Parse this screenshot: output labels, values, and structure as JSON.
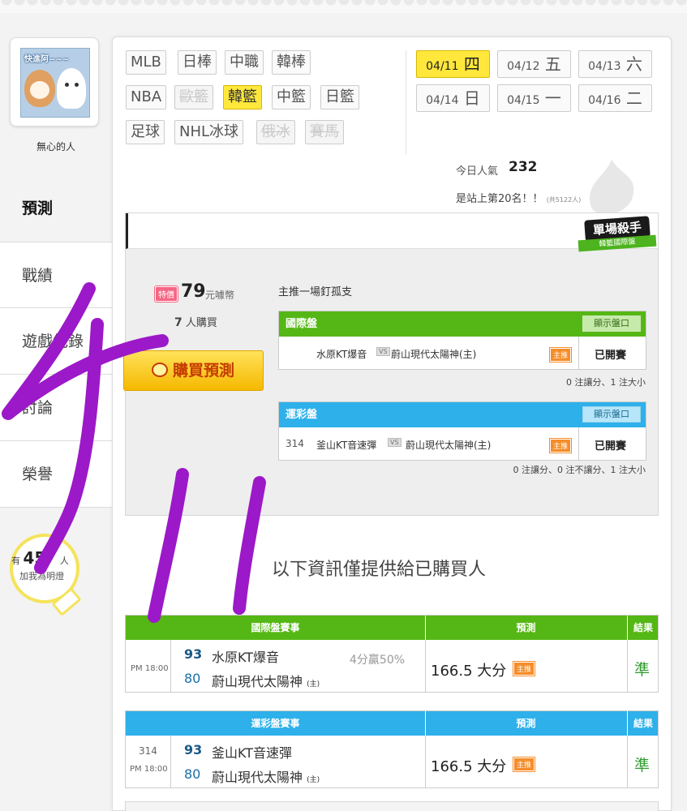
{
  "sidebar": {
    "avatar_caption": "快進阿~~~",
    "username": "無心的人",
    "nav": [
      {
        "label": "預測",
        "active": true
      },
      {
        "label": "戰績",
        "active": false
      },
      {
        "label": "遊戲紀錄",
        "active": false
      },
      {
        "label": "討論",
        "active": false
      },
      {
        "label": "榮譽",
        "active": false
      }
    ],
    "bulb": {
      "prefix": "有",
      "count": "45",
      "suffix": "人",
      "caption": "加我為明燈"
    }
  },
  "categories": [
    {
      "label": "MLB",
      "state": "normal"
    },
    {
      "label": "日棒",
      "state": "normal"
    },
    {
      "label": "中職",
      "state": "normal"
    },
    {
      "label": "韓棒",
      "state": "normal"
    },
    {
      "label": "NBA",
      "state": "normal"
    },
    {
      "label": "歐籃",
      "state": "disabled"
    },
    {
      "label": "韓籃",
      "state": "active"
    },
    {
      "label": "中籃",
      "state": "normal"
    },
    {
      "label": "日籃",
      "state": "normal"
    },
    {
      "label": "足球",
      "state": "normal"
    },
    {
      "label": "NHL冰球",
      "state": "normal"
    },
    {
      "label": "俄冰",
      "state": "disabled"
    },
    {
      "label": "賽馬",
      "state": "disabled"
    }
  ],
  "dates": [
    {
      "date": "04/11",
      "day": "四",
      "active": true
    },
    {
      "date": "04/12",
      "day": "五",
      "active": false
    },
    {
      "date": "04/13",
      "day": "六",
      "active": false
    },
    {
      "date": "04/14",
      "day": "日",
      "active": false
    },
    {
      "date": "04/15",
      "day": "一",
      "active": false
    },
    {
      "date": "04/16",
      "day": "二",
      "active": false
    }
  ],
  "popularity": {
    "label": "今日人氣",
    "count": "232",
    "rank_text": "是站上第20名！！",
    "rank_total": "(共5122人)"
  },
  "prediction": {
    "badge_main": "單場殺手",
    "badge_sub": "韓籃國際盤",
    "special_tag": "特價",
    "price": "79",
    "price_unit": "元噱幣",
    "buyers_count": "7",
    "buyers_suffix": "人購買",
    "buy_button": "購買預測",
    "main_pick": "主推一場釘孤支",
    "intl": {
      "title": "國際盤",
      "odds_button": "顯示盤口",
      "num": "",
      "home": "水原KT爆音",
      "away": "蔚山現代太陽神(主)",
      "pick_tag": "主推",
      "status": "已開賽",
      "summary": "0 注讓分、1 注大小"
    },
    "lottery": {
      "title": "運彩盤",
      "odds_button": "顯示盤口",
      "num": "314",
      "home": "釜山KT音速彈",
      "away": "蔚山現代太陽神(主)",
      "pick_tag": "主推",
      "status": "已開賽",
      "summary": "0 注讓分、0 注不讓分、1 注大小"
    }
  },
  "purchased_note": "以下資訊僅提供給已購買人",
  "results": {
    "intl": {
      "col_game": "國際盤賽事",
      "col_pred": "預測",
      "col_result": "結果",
      "num": "",
      "time": "PM 18:00",
      "score_top": "93",
      "team_top": "水原KT爆音",
      "score_bot": "80",
      "team_bot": "蔚山現代太陽神",
      "home_mark": "(主)",
      "handicap": "4分贏50%",
      "pred": "166.5 大分",
      "pred_tag": "主推",
      "result": "準"
    },
    "lottery": {
      "col_game": "運彩盤賽事",
      "col_pred": "預測",
      "col_result": "結果",
      "num": "314",
      "time": "PM 18:00",
      "score_top": "93",
      "team_top": "釜山KT音速彈",
      "score_bot": "80",
      "team_bot": "蔚山現代太陽神",
      "home_mark": "(主)",
      "handicap": "",
      "pred": "166.5 大分",
      "pred_tag": "主推",
      "result": "準"
    }
  },
  "colors": {
    "accent_yellow": "#ffe83b",
    "green_header": "#55b715",
    "blue_header": "#2eb0ea",
    "annotation_purple": "#9b19c8"
  }
}
